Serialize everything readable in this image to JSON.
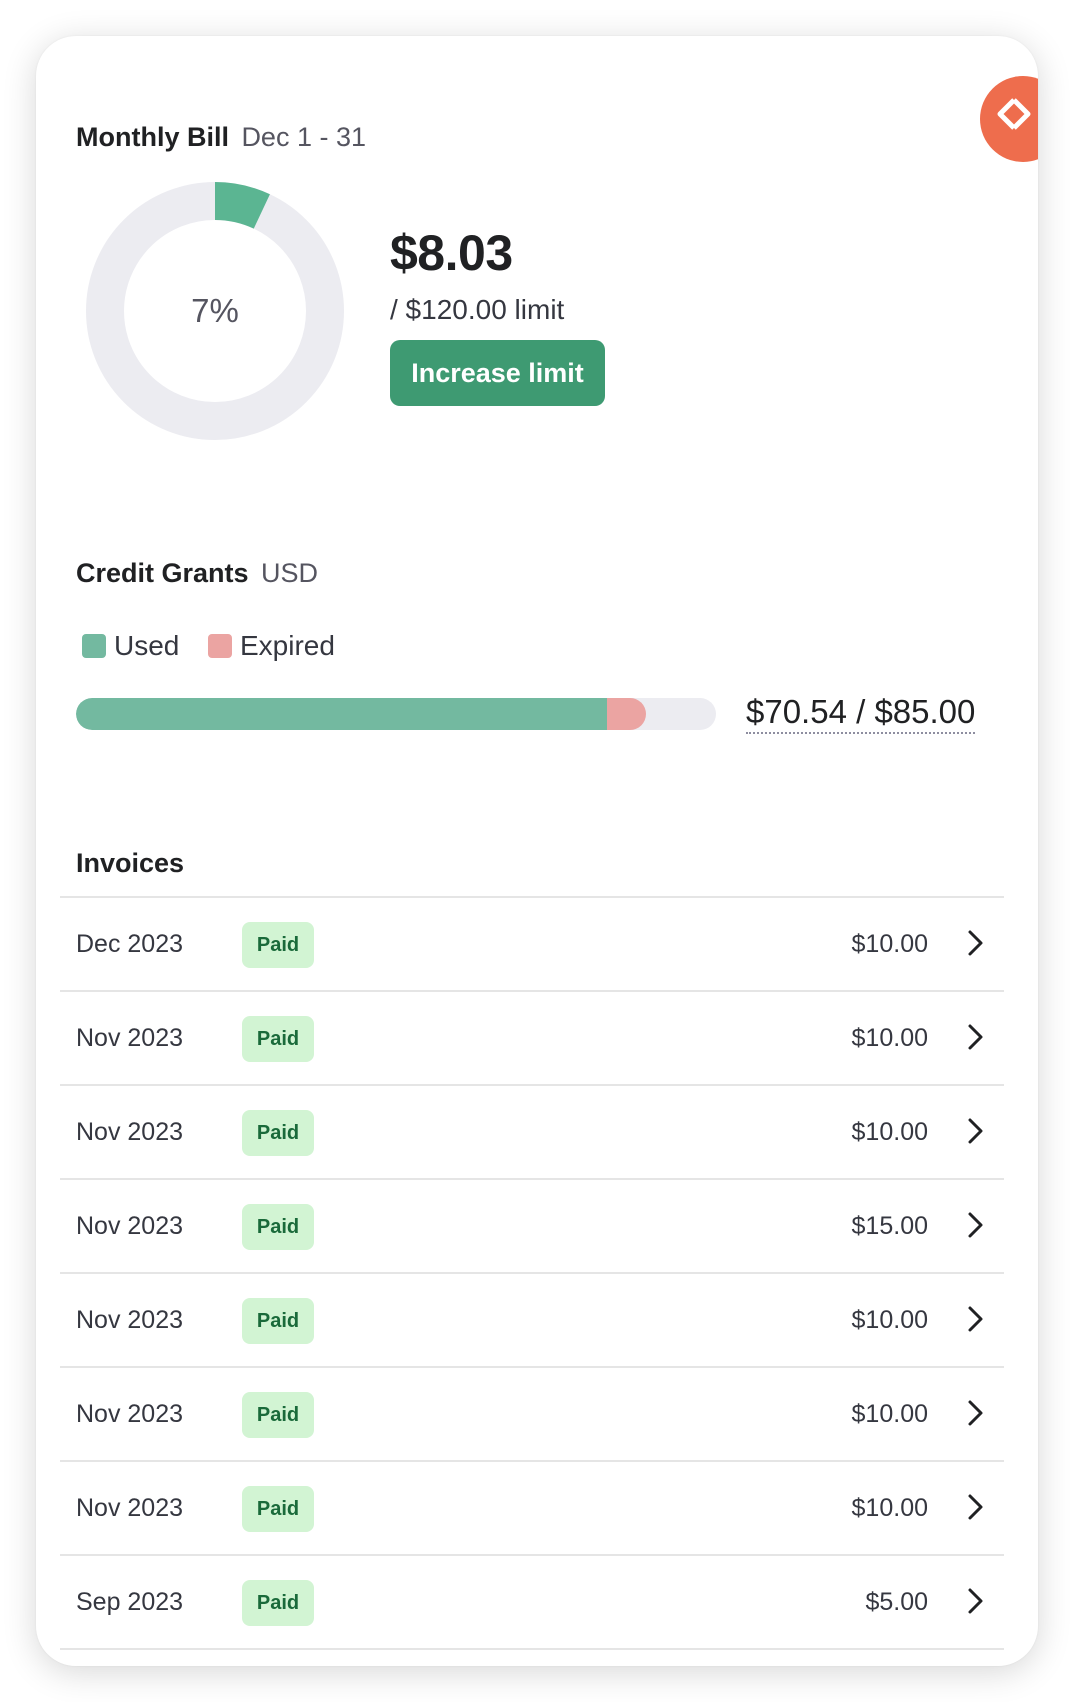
{
  "monthly_bill": {
    "title": "Monthly Bill",
    "period": "Dec 1 - 31",
    "percent_label": "7%",
    "percent_value": 0.07,
    "amount": "$8.03",
    "limit": "/ $120.00 limit",
    "increase_label": "Increase limit"
  },
  "credit_grants": {
    "title": "Credit Grants",
    "currency": "USD",
    "legend": [
      {
        "label": "Used",
        "color": "#73b9a0"
      },
      {
        "label": "Expired",
        "color": "#eba4a2"
      }
    ],
    "used_fraction": 0.83,
    "expired_fraction": 0.06,
    "total_label": "$70.54 / $85.00"
  },
  "invoices": {
    "title": "Invoices",
    "rows": [
      {
        "date": "Dec 2023",
        "status": "Paid",
        "amount": "$10.00"
      },
      {
        "date": "Nov 2023",
        "status": "Paid",
        "amount": "$10.00"
      },
      {
        "date": "Nov 2023",
        "status": "Paid",
        "amount": "$10.00"
      },
      {
        "date": "Nov 2023",
        "status": "Paid",
        "amount": "$15.00"
      },
      {
        "date": "Nov 2023",
        "status": "Paid",
        "amount": "$10.00"
      },
      {
        "date": "Nov 2023",
        "status": "Paid",
        "amount": "$10.00"
      },
      {
        "date": "Nov 2023",
        "status": "Paid",
        "amount": "$10.00"
      },
      {
        "date": "Sep 2023",
        "status": "Paid",
        "amount": "$5.00"
      }
    ]
  },
  "colors": {
    "accent_green": "#3e9a72",
    "donut_fill": "#5bb592",
    "donut_track": "#ececf1",
    "float_button": "#ee6d4d",
    "paid_badge_bg": "#d2f4d3"
  },
  "icons": {
    "float_button": "diamond-arrows-icon",
    "row_chevron": "chevron-right-icon"
  }
}
